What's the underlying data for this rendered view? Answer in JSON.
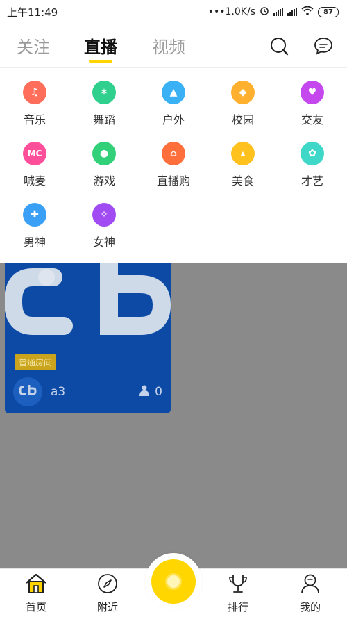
{
  "status_bar": {
    "time": "上午11:49",
    "net_speed": "•••1.0K/s",
    "battery": "87"
  },
  "top_tabs": [
    {
      "label": "关注",
      "active": false
    },
    {
      "label": "直播",
      "active": true
    },
    {
      "label": "视频",
      "active": false
    }
  ],
  "top_icons": [
    "search-icon",
    "message-icon"
  ],
  "categories": [
    {
      "label": "音乐",
      "icon": "music-icon",
      "color": "#ff6e5a"
    },
    {
      "label": "舞蹈",
      "icon": "dance-icon",
      "color": "#2fd08d"
    },
    {
      "label": "户外",
      "icon": "outdoor-icon",
      "color": "#3bb1f5"
    },
    {
      "label": "校园",
      "icon": "campus-icon",
      "color": "#ffb02e"
    },
    {
      "label": "交友",
      "icon": "friends-icon",
      "color": "#c548ee"
    },
    {
      "label": "喊麦",
      "icon": "mc-icon",
      "glyph": "MC",
      "color": "#ff4f9a"
    },
    {
      "label": "游戏",
      "icon": "game-icon",
      "color": "#33d07a"
    },
    {
      "label": "直播购",
      "icon": "shopping-icon",
      "color": "#ff6f3c"
    },
    {
      "label": "美食",
      "icon": "food-icon",
      "color": "#ffc11e"
    },
    {
      "label": "才艺",
      "icon": "talent-icon",
      "color": "#3fd8c8"
    },
    {
      "label": "男神",
      "icon": "male-icon",
      "color": "#3aa0f5"
    },
    {
      "label": "女神",
      "icon": "female-icon",
      "color": "#a04cf2"
    }
  ],
  "room": {
    "badge": "普通房间",
    "name": "a3",
    "viewers": "0"
  },
  "bottom_nav": [
    {
      "label": "首页",
      "icon": "home-icon"
    },
    {
      "label": "附近",
      "icon": "compass-icon"
    },
    {
      "label": "排行",
      "icon": "trophy-icon"
    },
    {
      "label": "我的",
      "icon": "profile-icon"
    }
  ],
  "colors": {
    "accent": "#ffd400",
    "overlay": "#8a8a8a",
    "room_card": "#0d4aa6"
  }
}
